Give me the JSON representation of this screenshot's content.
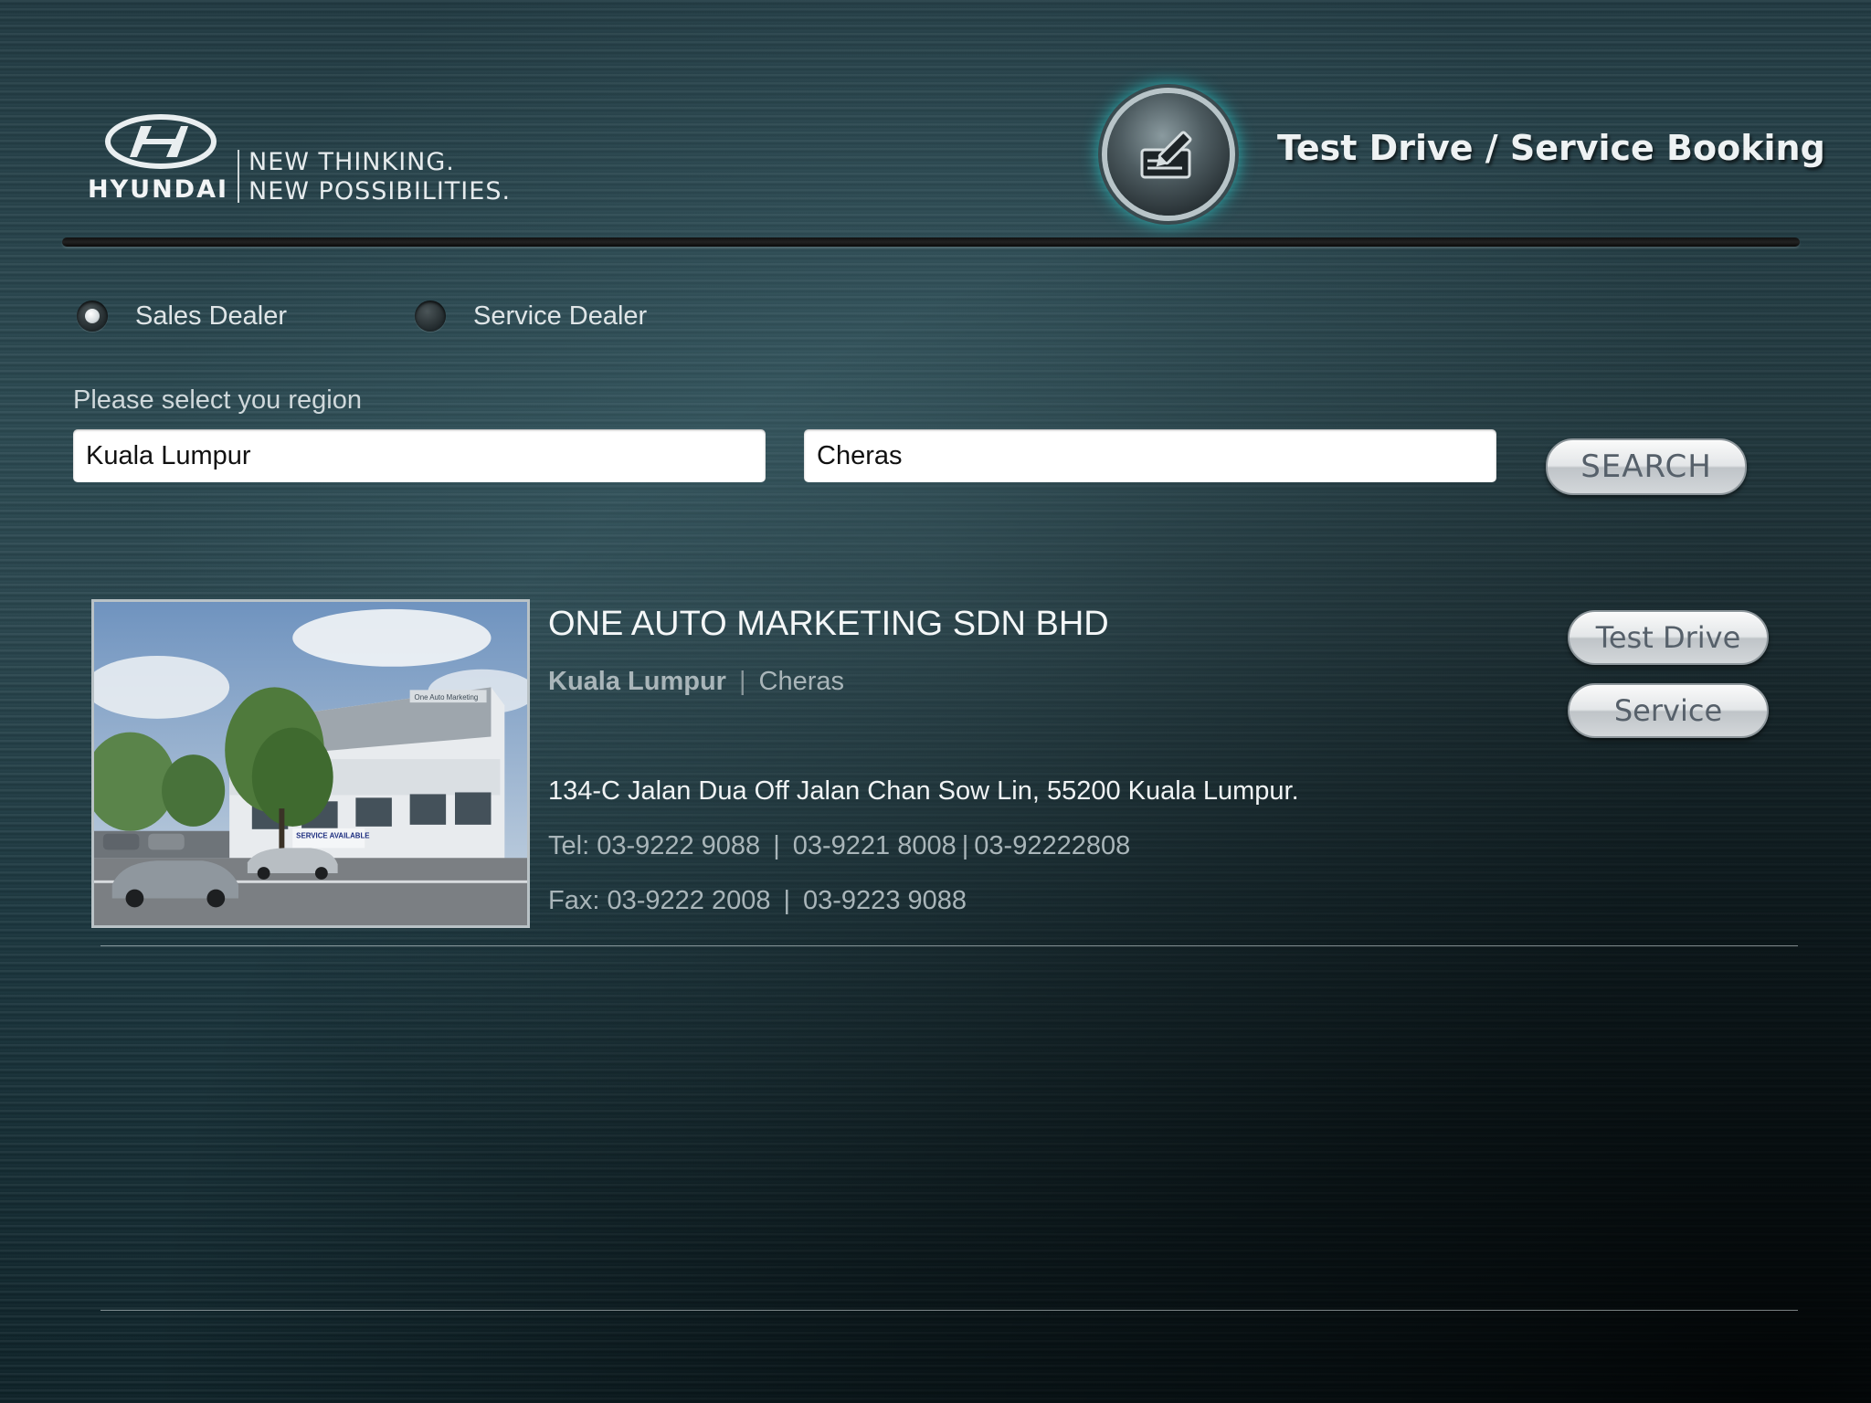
{
  "brand": {
    "wordmark": "HYUNDAI",
    "tagline_line1": "NEW THINKING.",
    "tagline_line2": "NEW POSSIBILITIES."
  },
  "header": {
    "icon": "edit-form-icon",
    "title": "Test Drive / Service Booking"
  },
  "dealer_type": {
    "options": [
      {
        "label": "Sales Dealer",
        "checked": true
      },
      {
        "label": "Service Dealer",
        "checked": false
      }
    ]
  },
  "region": {
    "prompt": "Please select you region",
    "state_value": "Kuala Lumpur",
    "area_value": "Cheras",
    "search_label": "SEARCH"
  },
  "results": [
    {
      "name": "ONE AUTO MARKETING SDN BHD",
      "state": "Kuala Lumpur",
      "area": "Cheras",
      "address": "134-C Jalan Dua Off Jalan Chan Sow Lin, 55200 Kuala Lumpur.",
      "tel_prefix": "Tel: ",
      "tel_1": "03-9222 9088",
      "tel_2": "03-9221 8008",
      "tel_3": "03-92222808",
      "fax_prefix": "Fax: ",
      "fax_1": "03-9222 2008",
      "fax_2": "03-9223 9088",
      "photo_signage": "One Auto Marketing",
      "photo_banner": "SERVICE AVAILABLE",
      "test_drive_label": "Test Drive",
      "service_label": "Service"
    }
  ],
  "colors": {
    "accent_glow": "#28d2d2",
    "background": "#1b3a42"
  }
}
